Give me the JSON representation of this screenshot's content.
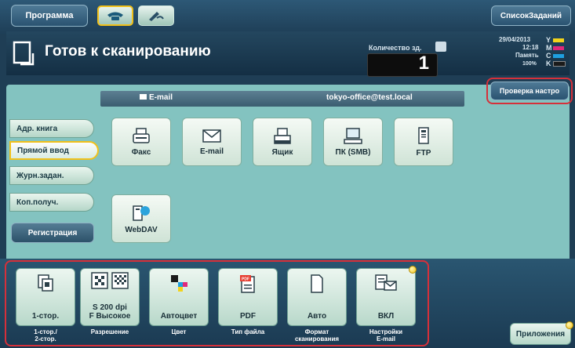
{
  "top": {
    "program_label": "Программа",
    "job_list_label": "СписокЗаданий"
  },
  "status": {
    "title": "Готов к сканированию",
    "copies_label": "Количество зд.",
    "copies_value": "1",
    "date": "29/04/2013",
    "time": "12:18",
    "memory_label": "Память",
    "memory_value": "100%",
    "toner": [
      {
        "letter": "Y",
        "color": "#f2d31b"
      },
      {
        "letter": "M",
        "color": "#e0287b"
      },
      {
        "letter": "C",
        "color": "#1e9fe0"
      },
      {
        "letter": "K",
        "color": "#1a1a1a"
      }
    ]
  },
  "destination": {
    "type_label": "E-mail",
    "address": "tokyo-office@test.local",
    "check_button": "Проверка настро"
  },
  "sidebar": {
    "items": [
      {
        "label": "Адр. книга"
      },
      {
        "label": "Прямой ввод"
      },
      {
        "label": "Журн.задан."
      },
      {
        "label": "Коп.получ."
      }
    ],
    "register_label": "Регистрация"
  },
  "dest_tiles": [
    {
      "label": "Факс",
      "icon": "fax-icon"
    },
    {
      "label": "E-mail",
      "icon": "email-icon"
    },
    {
      "label": "Ящик",
      "icon": "box-icon"
    },
    {
      "label": "ПК (SMB)",
      "icon": "pc-icon"
    },
    {
      "label": "FTP",
      "icon": "ftp-icon"
    },
    {
      "label": "WebDAV",
      "icon": "webdav-icon"
    }
  ],
  "settings": [
    {
      "value": "1-стор.",
      "label": "1-стор./\n2-стор.",
      "icon": "simplex-icon"
    },
    {
      "value": "S 200 dpi\nF Высокое",
      "label": "Разрешение",
      "icon": "resolution-icon"
    },
    {
      "value": "Автоцвет",
      "label": "Цвет",
      "icon": "color-icon"
    },
    {
      "value": "PDF",
      "label": "Тип файла",
      "icon": "pdf-icon"
    },
    {
      "value": "Авто",
      "label": "Формат\nсканирования",
      "icon": "page-icon"
    },
    {
      "value": "ВКЛ",
      "label": "Настройки\nE-mail",
      "icon": "email-settings-icon"
    }
  ],
  "apps_button": "Приложения"
}
